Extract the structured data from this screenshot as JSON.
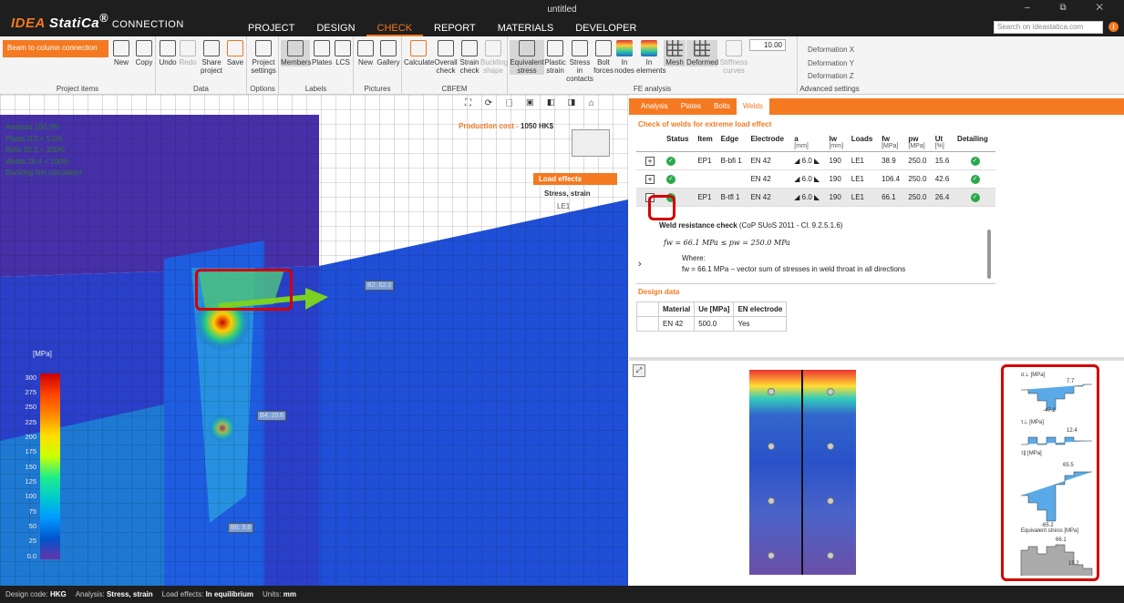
{
  "app": {
    "logo_idea": "IDEA",
    "logo_statica": "StatiCa",
    "logo_mark": "®",
    "product": "CONNECTION",
    "window_title": "untitled",
    "search_placeholder": "Search on ideastatica.com",
    "window_buttons": "– ⧉ ✕",
    "info": "i"
  },
  "nav": [
    "PROJECT",
    "DESIGN",
    "CHECK",
    "REPORT",
    "MATERIALS",
    "DEVELOPER"
  ],
  "ribbon": {
    "topology": "Beam to column connection",
    "groups": [
      "Project items",
      "Data",
      "Options",
      "Labels",
      "Pictures",
      "CBFEM",
      "FE analysis",
      "Advanced settings"
    ],
    "project_items": [
      "New",
      "Copy"
    ],
    "data": [
      "Undo",
      "Redo",
      "Share project",
      "Save"
    ],
    "options": [
      "Project settings"
    ],
    "labels": [
      "Members",
      "Plates",
      "LCS"
    ],
    "pictures": [
      "New",
      "Gallery"
    ],
    "cbfem": [
      "Calculate",
      "Overall check",
      "Strain check",
      "Buckling shape"
    ],
    "fe": [
      "Equivalent stress",
      "Plastic strain",
      "Stress in contacts",
      "Bolt forces",
      "In nodes",
      "In elements",
      "Mesh",
      "Deformed",
      "Stiffness curves"
    ],
    "deform_value": "10.00",
    "deformations": [
      "Deformation X",
      "Deformation Y",
      "Deformation Z"
    ]
  },
  "viewport": {
    "production_cost_label": "Production cost",
    "production_cost_value": "1050 HK$",
    "load_effects": "Load effects",
    "stress_strain": "Stress, strain",
    "le": "LE1",
    "status_items": [
      "Analysis 100.0%",
      "Plates 0.0 < 5.0%",
      "Bolts 92.3 < 100%",
      "Welds 26.4 < 100%",
      "Buckling Not calculated"
    ],
    "legend_title": "[MPa]",
    "legend_ticks": [
      "300",
      "275",
      "250",
      "225",
      "200",
      "175",
      "150",
      "125",
      "100",
      "75",
      "50",
      "25",
      "0.0"
    ],
    "tags": [
      "B2: 62.3",
      "B4: 20.6",
      "B6: 9.8"
    ],
    "toolbar": "⛶ ⟳ ⬚ ▣ ◧ ◨ ⌂"
  },
  "right": {
    "tabs": [
      "Analysis",
      "Plates",
      "Bolts",
      "Welds"
    ],
    "welds_title": "Check of welds for extreme load effect",
    "columns": [
      {
        "h": "Status",
        "u": ""
      },
      {
        "h": "Item",
        "u": ""
      },
      {
        "h": "Edge",
        "u": ""
      },
      {
        "h": "Electrode",
        "u": ""
      },
      {
        "h": "a",
        "u": "[mm]"
      },
      {
        "h": "lw",
        "u": "[mm]"
      },
      {
        "h": "Loads",
        "u": ""
      },
      {
        "h": "fw",
        "u": "[MPa]"
      },
      {
        "h": "pw",
        "u": "[MPa]"
      },
      {
        "h": "Ut",
        "u": "[%]"
      },
      {
        "h": "Detailing",
        "u": ""
      }
    ],
    "rows": [
      {
        "toggle": "+",
        "item": "EP1",
        "edge": "B-bfi 1",
        "electrode": "EN 42",
        "a": "◢ 6.0 ◣",
        "lw": "190",
        "loads": "LE1",
        "fw": "38.9",
        "pw": "250.0",
        "ut": "15.6"
      },
      {
        "toggle": "+",
        "item": "",
        "edge": "",
        "electrode": "EN 42",
        "a": "◢ 6.0 ◣",
        "lw": "190",
        "loads": "LE1",
        "fw": "106.4",
        "pw": "250.0",
        "ut": "42.6"
      },
      {
        "toggle": "−",
        "item": "EP1",
        "edge": "B-tfl 1",
        "electrode": "EN 42",
        "a": "◢ 6.0 ◣",
        "lw": "190",
        "loads": "LE1",
        "fw": "66.1",
        "pw": "250.0",
        "ut": "26.4"
      }
    ],
    "detail_title": "Weld resistance check",
    "detail_code": "(CoP SUoS 2011 - Cl. 9.2.5.1.6)",
    "detail_formula": "fw = 66.1 MPa ≤ pw = 250.0 MPa",
    "where": "Where:",
    "detail_expl": "fw = 66.1 MPa – vector sum of stresses in weld throat in all directions",
    "expand_arrow": "›",
    "design_title": "Design data",
    "design_cols": [
      "Material",
      "Ue [MPa]",
      "EN electrode"
    ],
    "design_row": [
      "EN 42",
      "500.0",
      "Yes"
    ],
    "expand_icon": "⤢",
    "charts": [
      {
        "label": "σ⊥ [MPa]",
        "v1": "7.7",
        "v2": "-47.2"
      },
      {
        "label": "τ⊥ [MPa]",
        "v1": "12.4",
        "v2": ""
      },
      {
        "label": "τ∥ [MPa]",
        "v1": "65.5",
        "v2": "-65.2"
      },
      {
        "label": "Equivalent stress [MPa]",
        "v1": "66.1",
        "v2": "15.2"
      }
    ]
  },
  "status": {
    "code_label": "Design code:",
    "code": "HKG",
    "analysis_label": "Analysis:",
    "analysis": "Stress, strain",
    "le_label": "Load effects:",
    "le": "In equilibrium",
    "units_label": "Units:",
    "units": "mm"
  }
}
